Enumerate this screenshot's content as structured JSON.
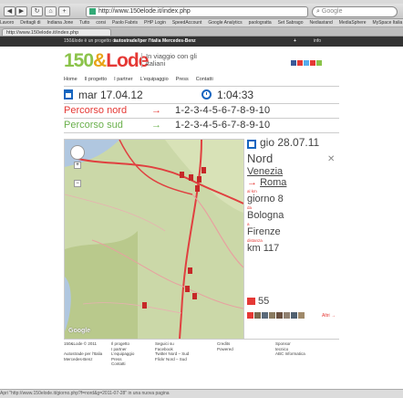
{
  "browser": {
    "url": "http://www.150elode.it/index.php",
    "search_placeholder": "Google",
    "tab_title": "http://www.150elode.it/index.php",
    "bookmarks": [
      "Lavoro",
      "Dettagli di",
      "Indiana Jone",
      "Tutto",
      "corsi",
      "Paolo Fabris",
      "PHP Login",
      "SpeedAccount",
      "Google Analytics",
      "paologratta",
      "Set Sabrago",
      "Nediastand",
      "MediaSphere",
      "MySpace Italia"
    ],
    "status_text": "Apri \"http://www.150elode.it/giorno.php?f=nord&g=2011-07-28\" in una nuova pagina"
  },
  "site": {
    "top_strip": {
      "project_of": "150&lode è un progetto di",
      "sponsor": "autostrade//per l'italia",
      "sponsor2": "Mercedes-Benz",
      "plus": "+",
      "plus_label": "info"
    },
    "logo": {
      "part1": "150",
      "part2": "&",
      "part3": "Lode"
    },
    "tagline": "In viaggio con gli italiani",
    "nav": [
      "Home",
      "Il progetto",
      "I partner",
      "L'equipaggio",
      "Press",
      "Contatti"
    ],
    "date": "mar 17.04.12",
    "time": "1:04:33",
    "routes": [
      {
        "name": "Percorso nord",
        "arrow": "→",
        "sequence": "1-2-3-4-5-6-7-8-9-10"
      },
      {
        "name": "Percorso sud",
        "arrow": "→",
        "sequence": "1-2-3-4-5-6-7-8-9-10"
      }
    ],
    "panel": {
      "date": "gio 28.07.11",
      "direction": "Nord",
      "from": "Venezia",
      "arrow": "→",
      "to": "Roma",
      "day_label": "al km",
      "day": "giorno 8",
      "city1_label": "da",
      "city1": "Bologna",
      "city2_label": "a",
      "city2": "Firenze",
      "distance_label": "distanza",
      "distance": "km 117",
      "photos_count": "55",
      "altro_link": "Altri →",
      "close": "✕"
    },
    "footer": {
      "col1": [
        "150&Lode © 2011",
        "",
        "Autostrade per l'Italia",
        "Mercedes-Benz"
      ],
      "col2": [
        "Il progetto",
        "I partner",
        "L'equipaggio",
        "Press",
        "Contatti"
      ],
      "col3": [
        "Seguici su",
        "Facebook",
        "Twitter Nord – Sud",
        "Flickr Nord – Sud"
      ],
      "col4": [
        "Credits",
        "Powered"
      ],
      "col5": [
        "Sponsor",
        "tecnico",
        "ABC Informatica"
      ]
    },
    "map_brand": "Google"
  }
}
